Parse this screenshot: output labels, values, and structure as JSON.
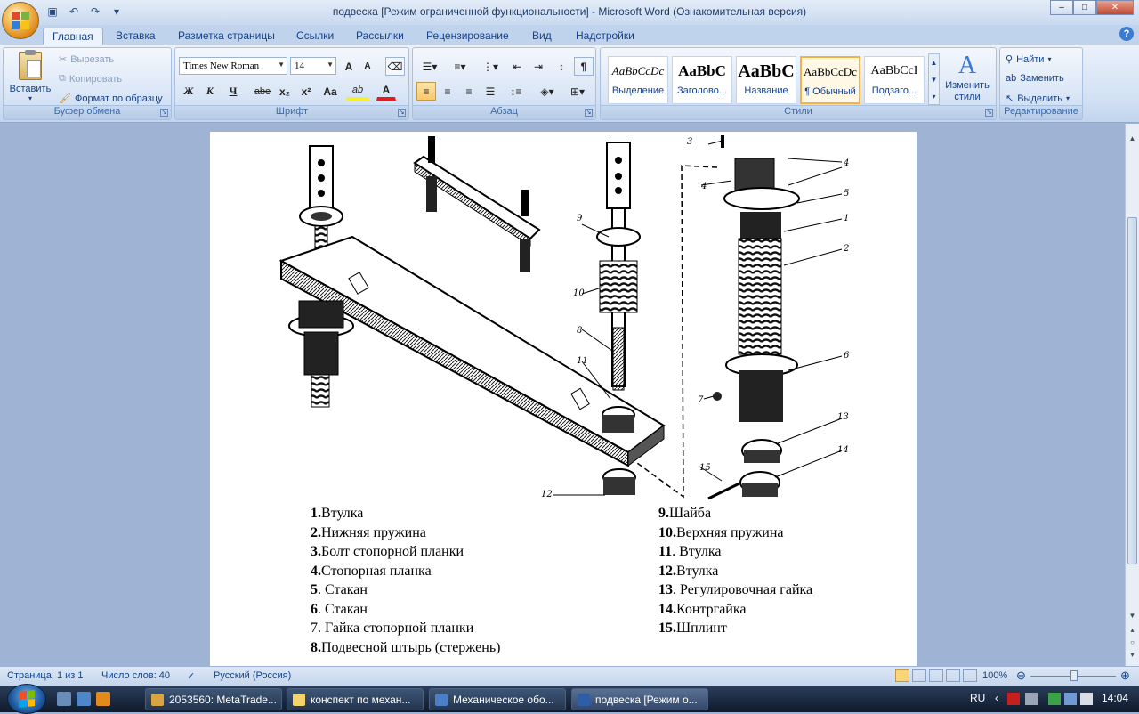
{
  "window": {
    "title": "подвеска [Режим ограниченной функциональности] - Microsoft Word (Ознакомительная версия)",
    "controls": {
      "minimize": "–",
      "maximize": "□",
      "close": "✕"
    }
  },
  "tabs": [
    "Главная",
    "Вставка",
    "Разметка страницы",
    "Ссылки",
    "Рассылки",
    "Рецензирование",
    "Вид",
    "Надстройки"
  ],
  "active_tab": "Главная",
  "clipboard": {
    "paste": "Вставить",
    "cut": "Вырезать",
    "copy": "Копировать",
    "format_painter": "Формат по образцу",
    "label": "Буфер обмена"
  },
  "font": {
    "family": "Times New Roman",
    "size": "14",
    "label": "Шрифт",
    "bold": "Ж",
    "italic": "К",
    "underline": "Ч",
    "strike": "abe",
    "sub": "x₂",
    "sup": "x²",
    "case": "Aa",
    "grow": "A",
    "shrink": "A",
    "highlight": "ab",
    "color": "A"
  },
  "paragraph": {
    "label": "Абзац",
    "pilcrow": "¶"
  },
  "styles": {
    "label": "Стили",
    "items": [
      {
        "sample": "AaBbCcDc",
        "name": "Выделение"
      },
      {
        "sample": "AaBbC",
        "name": "Заголово..."
      },
      {
        "sample": "AaBbC",
        "name": "Название"
      },
      {
        "sample": "AaBbCcDc",
        "name": "¶ Обычный"
      },
      {
        "sample": "AaBbCcI",
        "name": "Подзаго..."
      }
    ],
    "change": "Изменить стили"
  },
  "editing": {
    "label": "Редактирование",
    "find": "Найти",
    "replace": "Заменить",
    "select": "Выделить"
  },
  "document": {
    "figure_labels": [
      "3",
      "4",
      "4",
      "5",
      "1",
      "2",
      "6",
      "7",
      "13",
      "14",
      "15",
      "9",
      "10",
      "8",
      "11",
      "12"
    ],
    "legend_left": [
      {
        "n": "1.",
        "t": "Втулка"
      },
      {
        "n": "2.",
        "t": "Нижняя пружина"
      },
      {
        "n": "3.",
        "t": "Болт стопорной планки"
      },
      {
        "n": "4.",
        "t": "Стопорная планка"
      },
      {
        "n": "5",
        "t": ". Стакан"
      },
      {
        "n": "6",
        "t": ". Стакан"
      },
      {
        "n": "",
        "t": "7. Гайка стопорной планки"
      },
      {
        "n": "8.",
        "t": "Подвесной штырь (стержень)"
      }
    ],
    "legend_right": [
      {
        "n": "9.",
        "t": "Шайба"
      },
      {
        "n": "10.",
        "t": "Верхняя пружина"
      },
      {
        "n": "11",
        "t": ". Втулка"
      },
      {
        "n": "12.",
        "t": "Втулка"
      },
      {
        "n": "13",
        "t": ". Регулировочная гайка"
      },
      {
        "n": "14.",
        "t": "Контргайка"
      },
      {
        "n": "15.",
        "t": "Шплинт"
      }
    ]
  },
  "status": {
    "page": "Страница: 1 из 1",
    "words": "Число слов: 40",
    "language": "Русский (Россия)",
    "zoom": "100%",
    "zoom_level": 100
  },
  "taskbar": {
    "tasks": [
      {
        "label": "2053560: MetaTrade...",
        "color": "#d9a441"
      },
      {
        "label": "конспект по механ...",
        "color": "#f3d36b"
      },
      {
        "label": "Механическое обо...",
        "color": "#4a7fc8"
      },
      {
        "label": "подвеска [Режим о...",
        "color": "#2f5ea8"
      }
    ],
    "active_task": 3,
    "lang": "RU",
    "clock": "14:04"
  },
  "colors": {
    "accent": "#15428b",
    "ribbon": "#d2e1f4",
    "taskbar": "#1b2a40"
  }
}
